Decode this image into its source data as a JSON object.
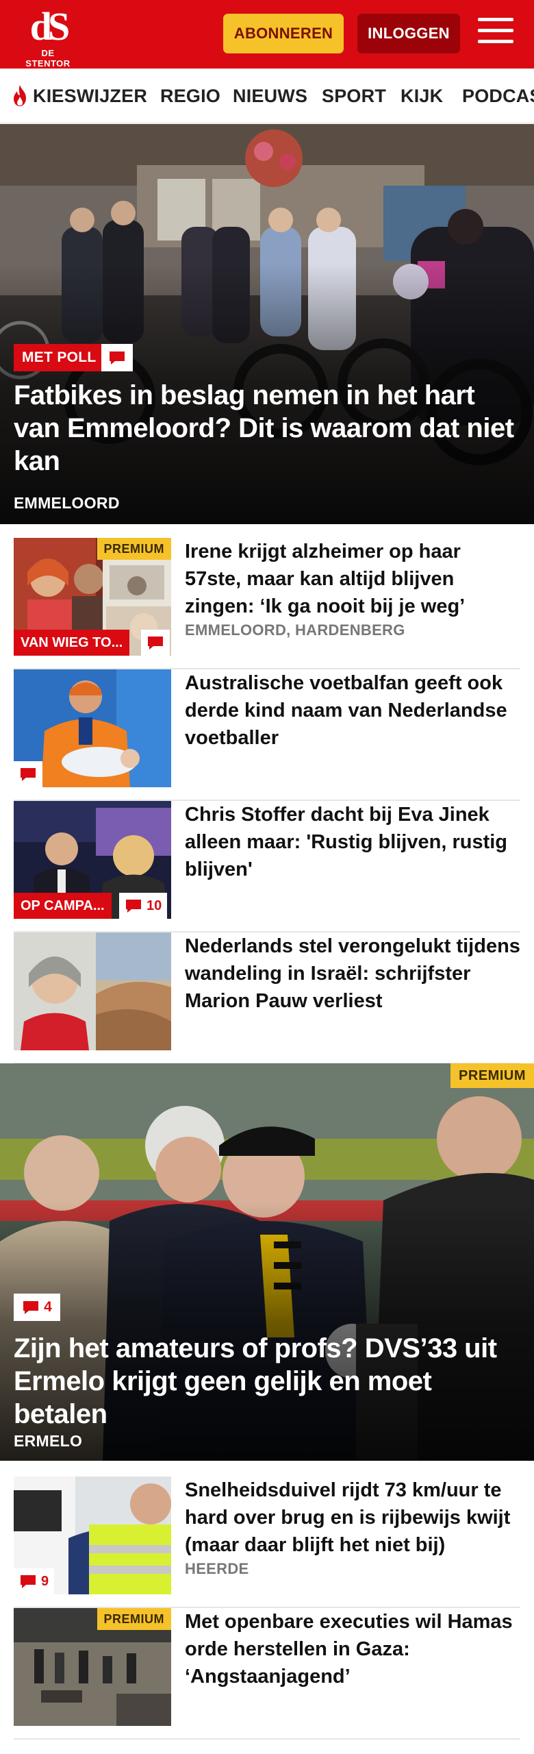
{
  "header": {
    "logo_mark": "dS",
    "logo_name": "DE STENTOR",
    "subscribe_label": "ABONNEREN",
    "login_label": "INLOGGEN",
    "brand_red": "#d90a12",
    "accent_yellow": "#f6c22a"
  },
  "nav": {
    "items": [
      {
        "label": "KIESWIJZER",
        "icon": "flame-icon"
      },
      {
        "label": "REGIO"
      },
      {
        "label": "NIEUWS"
      },
      {
        "label": "SPORT"
      },
      {
        "label": "KIJK"
      },
      {
        "label": "PODCAST"
      }
    ]
  },
  "hero1": {
    "tag": "MET POLL",
    "title": "Fatbikes in beslag nemen in het hart van Emmeloord? Dit is waarom dat niet kan",
    "location": "EMMELOORD"
  },
  "articles1": [
    {
      "title": "Irene krijgt alzheimer op haar 57ste, maar kan altijd blijven zingen: ‘Ik ga nooit bij je weg’",
      "location": "EMMELOORD, HARDENBERG",
      "thumb_tag": "VAN WIEG TO...",
      "premium": "PREMIUM",
      "comments": ""
    },
    {
      "title": "Australische voetbalfan geeft ook derde kind naam van Nederlandse voetballer",
      "location": "",
      "thumb_tag": "",
      "premium": "",
      "comments": ""
    },
    {
      "title": "Chris Stoffer dacht bij Eva Jinek alleen maar: 'Rustig blijven, rustig blijven'",
      "location": "",
      "thumb_tag": "OP CAMPA...",
      "premium": "",
      "comments": "10"
    },
    {
      "title": "Nederlands stel verongelukt tijdens wandeling in Israël: schrijfster Marion Pauw verliest",
      "location": "",
      "thumb_tag": "",
      "premium": "",
      "comments": ""
    }
  ],
  "hero2": {
    "premium": "PREMIUM",
    "comments": "4",
    "title": "Zijn het amateurs of profs? DVS’33 uit Ermelo krijgt geen gelijk en moet betalen",
    "location": "ERMELO"
  },
  "articles2": [
    {
      "title": "Snelheidsduivel rijdt 73 km/uur te hard over brug en is rijbewijs kwijt (maar daar blijft het niet bij)",
      "location": "HEERDE",
      "comments": "9",
      "premium": ""
    },
    {
      "title": "Met openbare executies wil Hamas orde herstellen in Gaza: ‘Angstaanjagend’",
      "location": "",
      "comments": "",
      "premium": "PREMIUM"
    }
  ]
}
